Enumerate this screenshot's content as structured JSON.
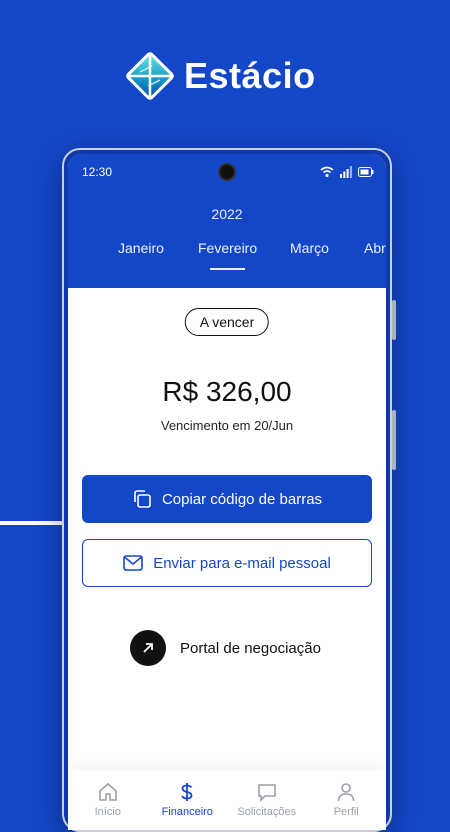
{
  "brand": {
    "name": "Estácio"
  },
  "status_bar": {
    "time": "12:30"
  },
  "header": {
    "year": "2022",
    "months": [
      {
        "label": "Janeiro"
      },
      {
        "label": "Fevereiro",
        "active": true
      },
      {
        "label": "Março"
      },
      {
        "label": "Abr"
      }
    ]
  },
  "bill": {
    "status": "A vencer",
    "amount": "R$ 326,00",
    "due": "Vencimento em 20/Jun",
    "copy_barcode_label": "Copiar código de barras",
    "email_label": "Enviar para e-mail pessoal",
    "portal_label": "Portal de negociação"
  },
  "tabs": [
    {
      "label": "Início",
      "icon": "home-icon"
    },
    {
      "label": "Financeiro",
      "icon": "dollar-icon",
      "active": true
    },
    {
      "label": "Solicitações",
      "icon": "chat-icon"
    },
    {
      "label": "Perfil",
      "icon": "user-icon"
    }
  ],
  "colors": {
    "primary": "#1446c8",
    "background": "#1446c8",
    "text": "#111111",
    "inactive": "#9aa0aa"
  }
}
